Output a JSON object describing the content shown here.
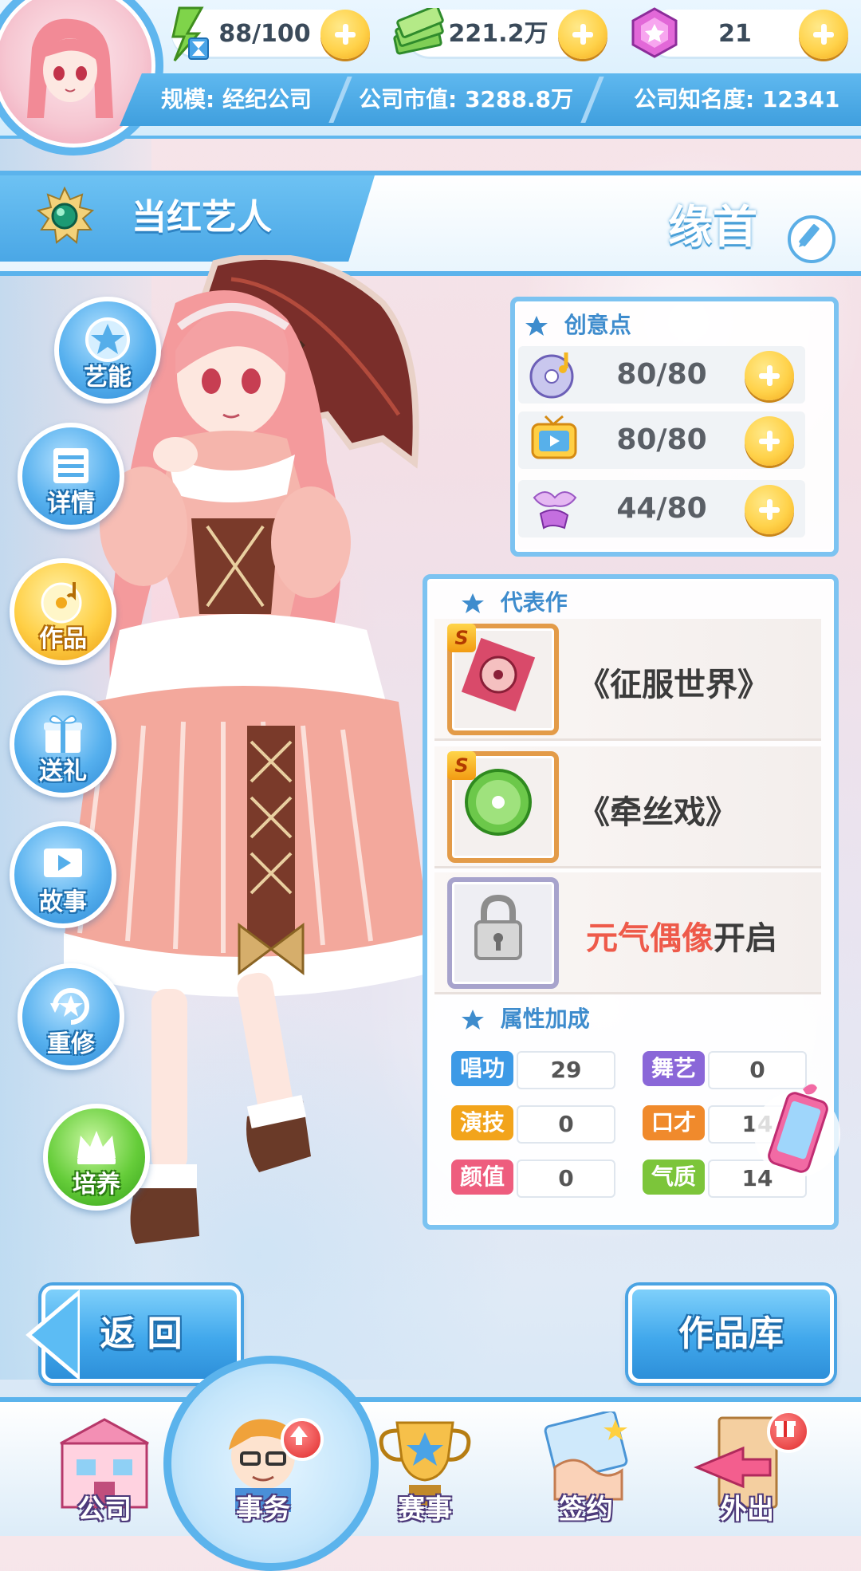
{
  "resources": {
    "energy": "88/100",
    "money": "221.2万",
    "gems": "21"
  },
  "company": {
    "scale": "规模: 经纪公司",
    "market_value": "公司市值: 3288.8万",
    "fame": "公司知名度: 12341"
  },
  "header": {
    "title": "当红艺人",
    "artist_name": "缘首"
  },
  "side_buttons": [
    {
      "label": "艺能"
    },
    {
      "label": "详情"
    },
    {
      "label": "作品"
    },
    {
      "label": "送礼"
    },
    {
      "label": "故事"
    },
    {
      "label": "重修"
    },
    {
      "label": "培养"
    }
  ],
  "creative_points": {
    "header": "创意点",
    "rows": [
      {
        "value": "80/80"
      },
      {
        "value": "80/80"
      },
      {
        "value": "44/80"
      }
    ]
  },
  "works": {
    "header": "代表作",
    "items": [
      {
        "title": "《征服世界》",
        "badge": "S"
      },
      {
        "title": "《牵丝戏》",
        "badge": "S"
      }
    ],
    "locked": {
      "highlight": "元气偶像",
      "suffix": "开启"
    }
  },
  "attributes": {
    "header": "属性加成",
    "items": [
      {
        "label": "唱功",
        "value": "29",
        "color": "#3d9ae6"
      },
      {
        "label": "舞艺",
        "value": "0",
        "color": "#8a67d8"
      },
      {
        "label": "演技",
        "value": "0",
        "color": "#f2a41b"
      },
      {
        "label": "口才",
        "value": "14",
        "color": "#f08a2c"
      },
      {
        "label": "颜值",
        "value": "0",
        "color": "#ee5d7e"
      },
      {
        "label": "气质",
        "value": "14",
        "color": "#7cc53a"
      }
    ]
  },
  "buttons": {
    "back": "返 回",
    "library": "作品库"
  },
  "nav": [
    {
      "label": "公司"
    },
    {
      "label": "事务"
    },
    {
      "label": "赛事"
    },
    {
      "label": "签约"
    },
    {
      "label": "外出"
    }
  ]
}
